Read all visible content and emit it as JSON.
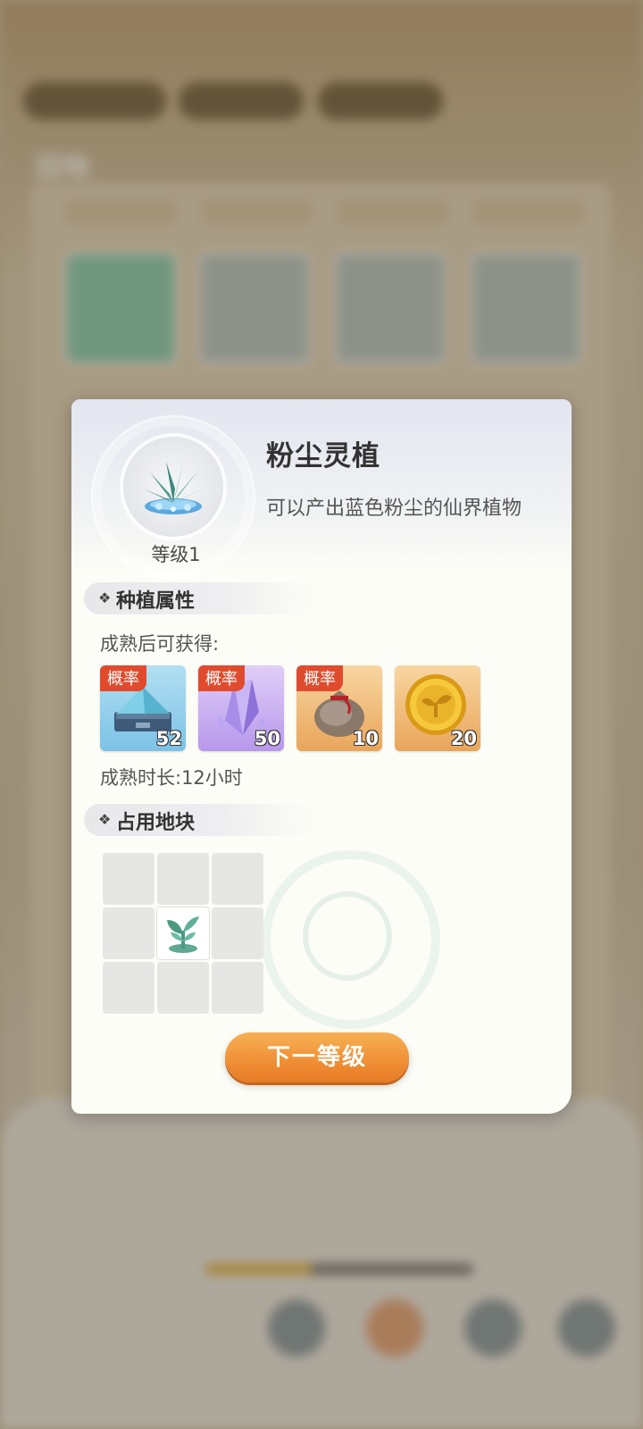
{
  "background": {
    "screen_title": "田地"
  },
  "dialog": {
    "plant": {
      "name": "粉尘灵植",
      "description": "可以产出蓝色粉尘的仙界植物",
      "level_label": "等级1",
      "icon": "blue-crystal-plant-icon"
    },
    "planting_attributes": {
      "title": "种植属性",
      "rewards_label": "成熟后可获得:",
      "rewards": [
        {
          "icon": "blue-dust-pile-icon",
          "badge": "概率",
          "count": "52",
          "color": "blue"
        },
        {
          "icon": "purple-crystal-icon",
          "badge": "概率",
          "count": "50",
          "color": "purple"
        },
        {
          "icon": "loot-sack-icon",
          "badge": "概率",
          "count": "10",
          "color": "orange"
        },
        {
          "icon": "gold-sprout-coin-icon",
          "badge": "",
          "count": "20",
          "color": "orange"
        }
      ],
      "mature_time": "成熟时长:12小时"
    },
    "occupied_plot": {
      "title": "占用地块",
      "grid_size": "3x3",
      "occupied_cell_icon": "seedling-icon"
    },
    "next_level_button": "下一等级",
    "colors": {
      "accent": "#ef8e34",
      "badge": "#e04b2e"
    }
  }
}
